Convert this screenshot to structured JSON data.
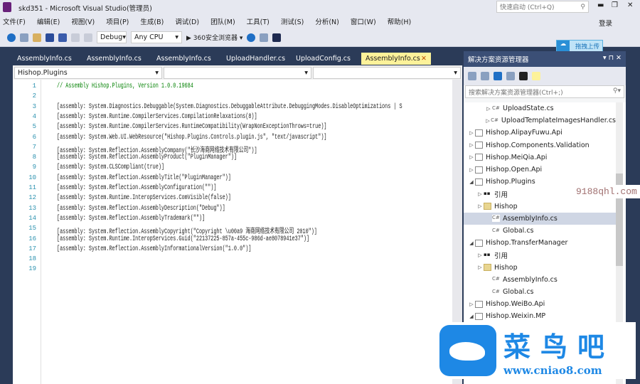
{
  "window": {
    "title": "skd351 - Microsoft Visual Studio(管理员)",
    "quick_launch": "快速启动 (Ctrl+Q)",
    "login": "登录"
  },
  "menu": [
    "文件(F)",
    "编辑(E)",
    "视图(V)",
    "项目(P)",
    "生成(B)",
    "调试(D)",
    "团队(M)",
    "工具(T)",
    "测试(S)",
    "分析(N)",
    "窗口(W)",
    "帮助(H)"
  ],
  "toolbar": {
    "config": "Debug",
    "platform": "Any CPU",
    "browser": "360安全浏览器",
    "upload": "拖拽上传"
  },
  "tabs": [
    "AssemblyInfo.cs",
    "AssemblyInfo.cs",
    "AssemblyInfo.cs",
    "UploadHandler.cs",
    "UploadConfig.cs",
    "AssemblyInfo.cs"
  ],
  "navbar": {
    "project": "Hishop.Plugins"
  },
  "code": [
    "// Assembly Hishop.Plugins, Version 1.0.0.19684",
    "",
    "[assembly: System.Diagnostics.Debuggable(System.Diagnostics.DebuggableAttribute.DebuggingModes.DisableOptimizations | S",
    "[assembly: System.Runtime.CompilerServices.CompilationRelaxations(8)]",
    "[assembly: System.Runtime.CompilerServices.RuntimeCompatibility(WrapNonExceptionThrows=true)]",
    "[assembly: System.Web.UI.WebResource(\"Hishop.Plugins.Controls.plugin.js\", \"text/javascript\")]",
    "[assembly: System.Reflection.AssemblyCompany(\"长沙海商网络技术有限公司\")]",
    "[assembly: System.Reflection.AssemblyProduct(\"PluginManager\")]",
    "[assembly: System.CLSCompliant(true)]",
    "[assembly: System.Reflection.AssemblyTitle(\"PluginManager\")]",
    "[assembly: System.Reflection.AssemblyConfiguration(\"\")]",
    "[assembly: System.Runtime.InteropServices.ComVisible(false)]",
    "[assembly: System.Reflection.AssemblyDescription(\"Debug\")]",
    "[assembly: System.Reflection.AssemblyTrademark(\"\")]",
    "[assembly: System.Reflection.AssemblyCopyright(\"Copyright \\u00a9 海商网络技术有限公司 2010\")]",
    "[assembly: System.Runtime.InteropServices.Guid(\"22137225-857a-455c-986d-ae8078941e37\")]",
    "[assembly: System.Reflection.AssemblyInformationalVersion(\"1.0.0\")]",
    "",
    ""
  ],
  "solution_explorer": {
    "title": "解决方案资源管理器",
    "search": "搜索解决方案资源管理器(Ctrl+;)",
    "items": [
      {
        "label": "UploadState.cs",
        "level": 2,
        "kind": "cs",
        "arrow": "▷"
      },
      {
        "label": "UploadTemplateImagesHandler.cs",
        "level": 2,
        "kind": "cs",
        "arrow": "▷"
      },
      {
        "label": "Hishop.AlipayFuwu.Api",
        "level": 0,
        "kind": "proj",
        "arrow": "▷"
      },
      {
        "label": "Hishop.Components.Validation",
        "level": 0,
        "kind": "proj",
        "arrow": "▷"
      },
      {
        "label": "Hishop.MeiQia.Api",
        "level": 0,
        "kind": "proj",
        "arrow": "▷"
      },
      {
        "label": "Hishop.Open.Api",
        "level": 0,
        "kind": "proj",
        "arrow": "▷"
      },
      {
        "label": "Hishop.Plugins",
        "level": 0,
        "kind": "proj",
        "arrow": "◢"
      },
      {
        "label": "引用",
        "level": 1,
        "kind": "ref",
        "arrow": "▷"
      },
      {
        "label": "Hishop",
        "level": 1,
        "kind": "folder",
        "arrow": "▷"
      },
      {
        "label": "AssemblyInfo.cs",
        "level": 2,
        "kind": "cs",
        "arrow": "",
        "selected": true
      },
      {
        "label": "Global.cs",
        "level": 2,
        "kind": "cs",
        "arrow": ""
      },
      {
        "label": "Hishop.TransferManager",
        "level": 0,
        "kind": "proj",
        "arrow": "◢"
      },
      {
        "label": "引用",
        "level": 1,
        "kind": "ref",
        "arrow": "▷"
      },
      {
        "label": "Hishop",
        "level": 1,
        "kind": "folder",
        "arrow": "▷"
      },
      {
        "label": "AssemblyInfo.cs",
        "level": 2,
        "kind": "cs",
        "arrow": ""
      },
      {
        "label": "Global.cs",
        "level": 2,
        "kind": "cs",
        "arrow": ""
      },
      {
        "label": "Hishop.WeiBo.Api",
        "level": 0,
        "kind": "proj",
        "arrow": "▷"
      },
      {
        "label": "Hishop.Weixin.MP",
        "level": 0,
        "kind": "proj",
        "arrow": "◢"
      }
    ]
  },
  "watermarks": {
    "site1": "9188qhl.com",
    "brand": "菜鸟吧",
    "brand_url": "www.cniao8.com"
  },
  "colors": {
    "frame": "#2b3b58",
    "active_tab": "#fdf29a",
    "brand": "#1e88e5"
  }
}
